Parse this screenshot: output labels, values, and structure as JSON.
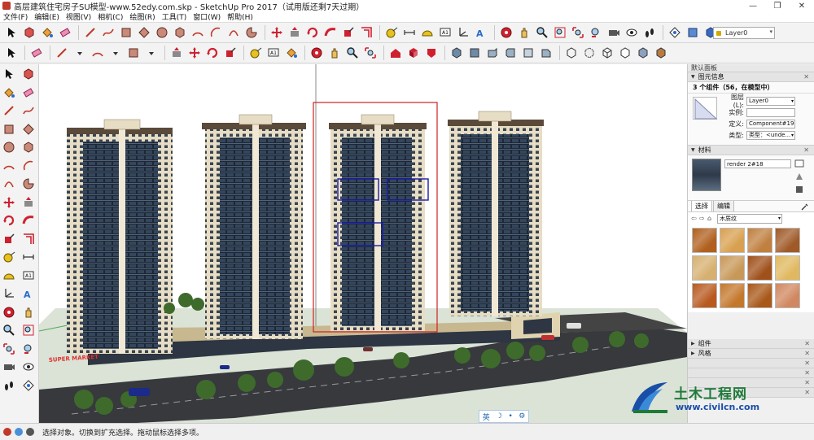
{
  "window": {
    "title": "高层建筑住宅房子SU模型-www.52edy.com.skp - SketchUp Pro 2017（试用版还剩7天过期）",
    "minimize": "—",
    "restore": "❐",
    "close": "✕"
  },
  "menu": [
    {
      "label": "文件(F)"
    },
    {
      "label": "编辑(E)"
    },
    {
      "label": "视图(V)"
    },
    {
      "label": "相机(C)"
    },
    {
      "label": "绘图(R)"
    },
    {
      "label": "工具(T)"
    },
    {
      "label": "窗口(W)"
    },
    {
      "label": "帮助(H)"
    }
  ],
  "layer_select": {
    "value": "Layer0"
  },
  "panel": {
    "header": "默认面板",
    "entity_section": "图元信息",
    "entity_title": "3 个组件（56，在模型中）",
    "props": [
      {
        "label": "图层(L):",
        "value": "Layer0",
        "dropdown": true
      },
      {
        "label": "实例:",
        "value": "",
        "dropdown": false
      },
      {
        "label": "定义:",
        "value": "Component#19",
        "dropdown": false
      },
      {
        "label": "类型:",
        "value": "类型：<unde...",
        "dropdown": true
      }
    ],
    "materials_section": "材料",
    "material_name": "render 2#18",
    "tabs": [
      {
        "label": "选择"
      },
      {
        "label": "编辑"
      }
    ],
    "library": "木质纹",
    "swatches": [
      "#b0601e",
      "#d8a050",
      "#c08040",
      "#a05a28",
      "#d6b070",
      "#c89858",
      "#a0501a",
      "#e0b860",
      "#b85a20",
      "#c4782c",
      "#a85818",
      "#d08860"
    ],
    "collapsed_sections": [
      {
        "label": "组件"
      },
      {
        "label": "风格"
      }
    ]
  },
  "status": {
    "text": "选择对象。切换到扩充选择。拖动鼠标选择多项。"
  },
  "ime": {
    "lang": "英",
    "moon": "☽",
    "dot": "•",
    "gear": "⚙"
  },
  "sign": {
    "text": "SUPER MARKET"
  },
  "watermark": {
    "title": "土木工程网",
    "url": "www.civilcn.com"
  },
  "colors": {
    "selection_red": "#d02020",
    "selection_blue": "#1a1aa8",
    "facade_cream": "#e6ddc4",
    "glass_dark": "#1c2838"
  }
}
